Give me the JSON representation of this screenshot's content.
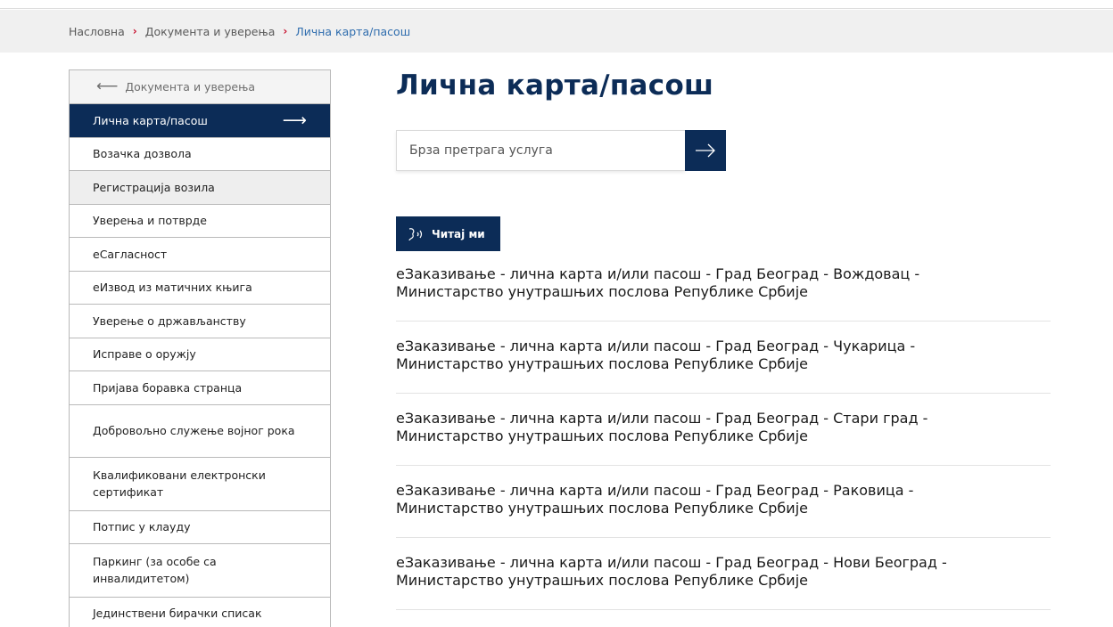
{
  "breadcrumb": {
    "home": "Насловна",
    "section": "Документа и уверења",
    "current": "Лична карта/пасош",
    "separator": "›"
  },
  "sidebar": {
    "back_arrow": "⟵",
    "back_label": "Документа и уверења",
    "active_arrow": "⟶",
    "items": [
      {
        "label": "Лична карта/пасош"
      },
      {
        "label": "Возачка дозвола"
      },
      {
        "label": "Регистрација возила"
      },
      {
        "label": "Уверења и потврде"
      },
      {
        "label": "еСагласност"
      },
      {
        "label": "еИзвод из матичних књига"
      },
      {
        "label": "Уверење о држављанству"
      },
      {
        "label": "Исправе о оружју"
      },
      {
        "label": "Пријава боравка странца"
      },
      {
        "label": "Добровољно служење војног рока"
      },
      {
        "label": "Квалификовани електронски сертификат"
      },
      {
        "label": "Потпис у клауду"
      },
      {
        "label": "Паркинг (за особе са инвалидитетом)"
      },
      {
        "label": "Јединствени бирачки списак"
      }
    ]
  },
  "main": {
    "title": "Лична карта/пасош",
    "search_placeholder": "Брза претрага услуга",
    "read_me_label": "Читај ми",
    "results": [
      {
        "line1": "еЗаказивање - лична карта и/или пасош - Град Београд - Вождовац -",
        "line2": "Министарство унутрашњих послова Републике Србије"
      },
      {
        "line1": "еЗаказивање - лична карта и/или пасош - Град Београд - Чукарица -",
        "line2": "Министарство унутрашњих послова Републике Србије"
      },
      {
        "line1": "еЗаказивање - лична карта и/или пасош - Град Београд - Стари град -",
        "line2": "Министарство унутрашњих послова Републике Србије"
      },
      {
        "line1": "еЗаказивање - лична карта и/или пасош - Град Београд - Раковица -",
        "line2": "Министарство унутрашњих послова Републике Србије"
      },
      {
        "line1": "еЗаказивање - лична карта и/или пасош - Град Београд - Нови Београд -",
        "line2": "Министарство унутрашњих послова Републике Србије"
      }
    ]
  },
  "colors": {
    "primary": "#0c2c57",
    "breadcrumb_link": "#2f6dae",
    "breadcrumb_separator": "#c8102e"
  }
}
